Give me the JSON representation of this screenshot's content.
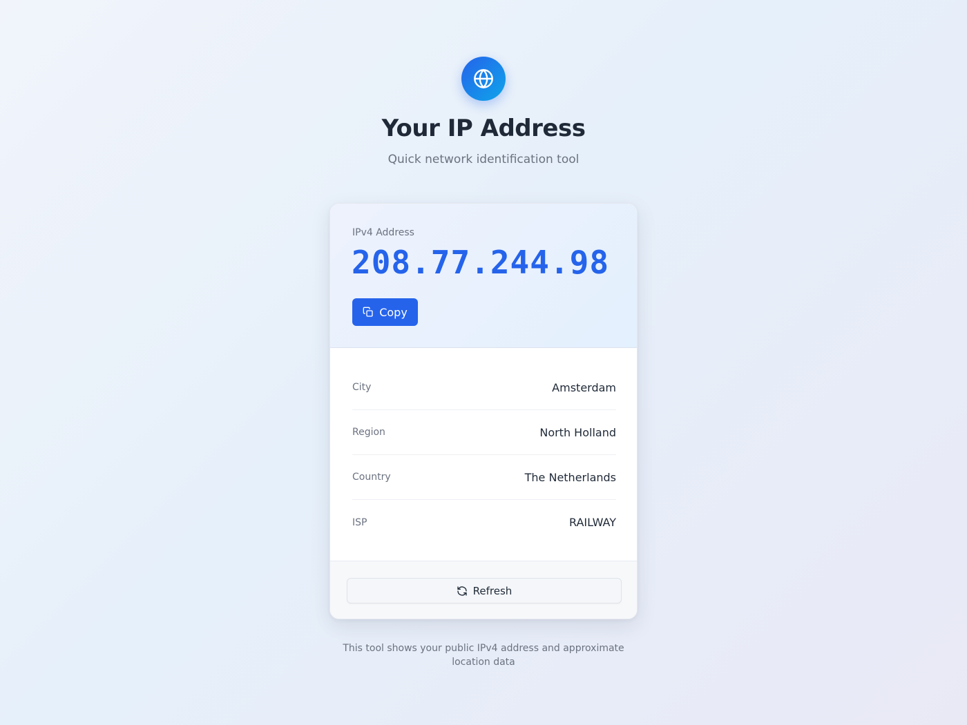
{
  "header": {
    "icon": "globe-icon",
    "title": "Your IP Address",
    "subtitle": "Quick network identification tool"
  },
  "ip": {
    "label": "IPv4 Address",
    "value": "208.77.244.98",
    "copy_label": "Copy",
    "copy_icon": "copy-icon"
  },
  "details": [
    {
      "label": "City",
      "value": "Amsterdam"
    },
    {
      "label": "Region",
      "value": "North Holland"
    },
    {
      "label": "Country",
      "value": "The Netherlands"
    },
    {
      "label": "ISP",
      "value": "RAILWAY"
    }
  ],
  "footer": {
    "refresh_label": "Refresh",
    "refresh_icon": "refresh-icon"
  },
  "footnote": "This tool shows your public IPv4 address and approximate location data",
  "colors": {
    "accent": "#2563eb",
    "accent_light": "#0ea5e9",
    "text_primary": "#1f2937",
    "text_secondary": "#6b7280"
  }
}
